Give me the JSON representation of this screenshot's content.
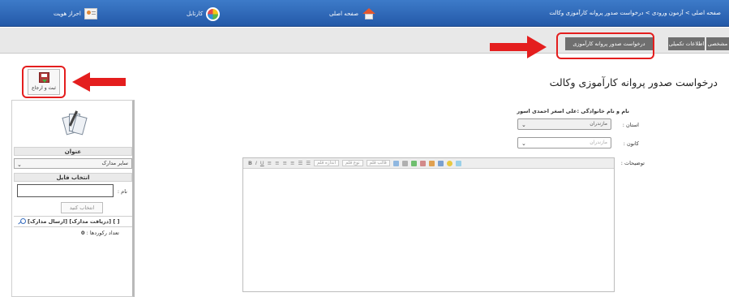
{
  "topbar": {
    "breadcrumb": [
      "صفحه اصلی",
      "آزمون ورودی",
      "درخواست صدور پروانه کارآموزی وکالت"
    ],
    "breadcrumb_sep": " > ",
    "home_label": "صفحه اصلی",
    "cartabl_label": "کارتابل",
    "auth_label": "احراز هویت"
  },
  "tabs": {
    "main": "مشخصی",
    "info": "اطلاعات تکمیلی",
    "request": "درخواست صدور پروانه کارآموزی"
  },
  "page": {
    "title": "درخواست صدور پروانه کارآموزی وکالت"
  },
  "toolbar": {
    "save_label": "ثبت و ارجاع"
  },
  "left_panel": {
    "title_header": "عنوان",
    "title_value": "سایر مدارک",
    "file_header": "انتخاب فایل",
    "name_label": "نام :",
    "choose_button": "انتخاب کنید",
    "links": "[ارسال مدارک] [دریافت مدارک] [ ]",
    "records_label": "تعداد رکوردها :",
    "records_count": "0"
  },
  "form": {
    "fullname": "نام و نام خانوادگی :علی اصغر احمدی اسور",
    "province_label": "استان :",
    "province_value": "مازندران",
    "center_label": "کانون :",
    "center_value": "مازندران",
    "description_label": "توضیحات :"
  },
  "editor": {
    "font_size_placeholder": "اندازه قلم",
    "font_type_placeholder": "نوع قلم",
    "format_placeholder": "قالب قلم",
    "bold": "B",
    "italic": "I",
    "underline": "U"
  },
  "colors": {
    "topbar": "#2f6bbd",
    "tab": "#6f6f6f",
    "highlight_red": "#e41e1e"
  }
}
